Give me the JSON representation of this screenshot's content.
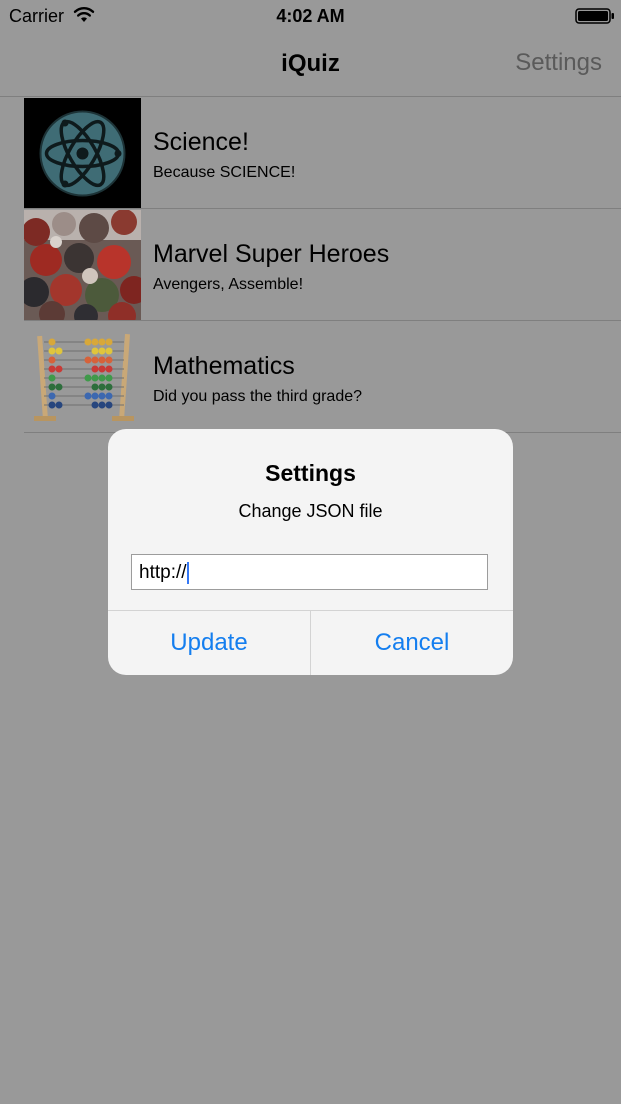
{
  "status_bar": {
    "carrier": "Carrier",
    "time": "4:02 AM",
    "icons": [
      "wifi-icon",
      "battery-icon"
    ]
  },
  "nav": {
    "title": "iQuiz",
    "settings_label": "Settings"
  },
  "quizzes": [
    {
      "title": "Science!",
      "subtitle": "Because SCIENCE!",
      "icon": "atom-icon"
    },
    {
      "title": "Marvel Super Heroes",
      "subtitle": "Avengers, Assemble!",
      "icon": "marvel-heroes-image"
    },
    {
      "title": "Mathematics",
      "subtitle": "Did you pass the third grade?",
      "icon": "abacus-icon"
    }
  ],
  "alert": {
    "title": "Settings",
    "message": "Change JSON file",
    "input_value": "http://",
    "buttons": {
      "update": "Update",
      "cancel": "Cancel"
    }
  },
  "colors": {
    "dimmed_background": "#999999",
    "accent": "#147eef",
    "alert_background": "#f4f4f4"
  }
}
